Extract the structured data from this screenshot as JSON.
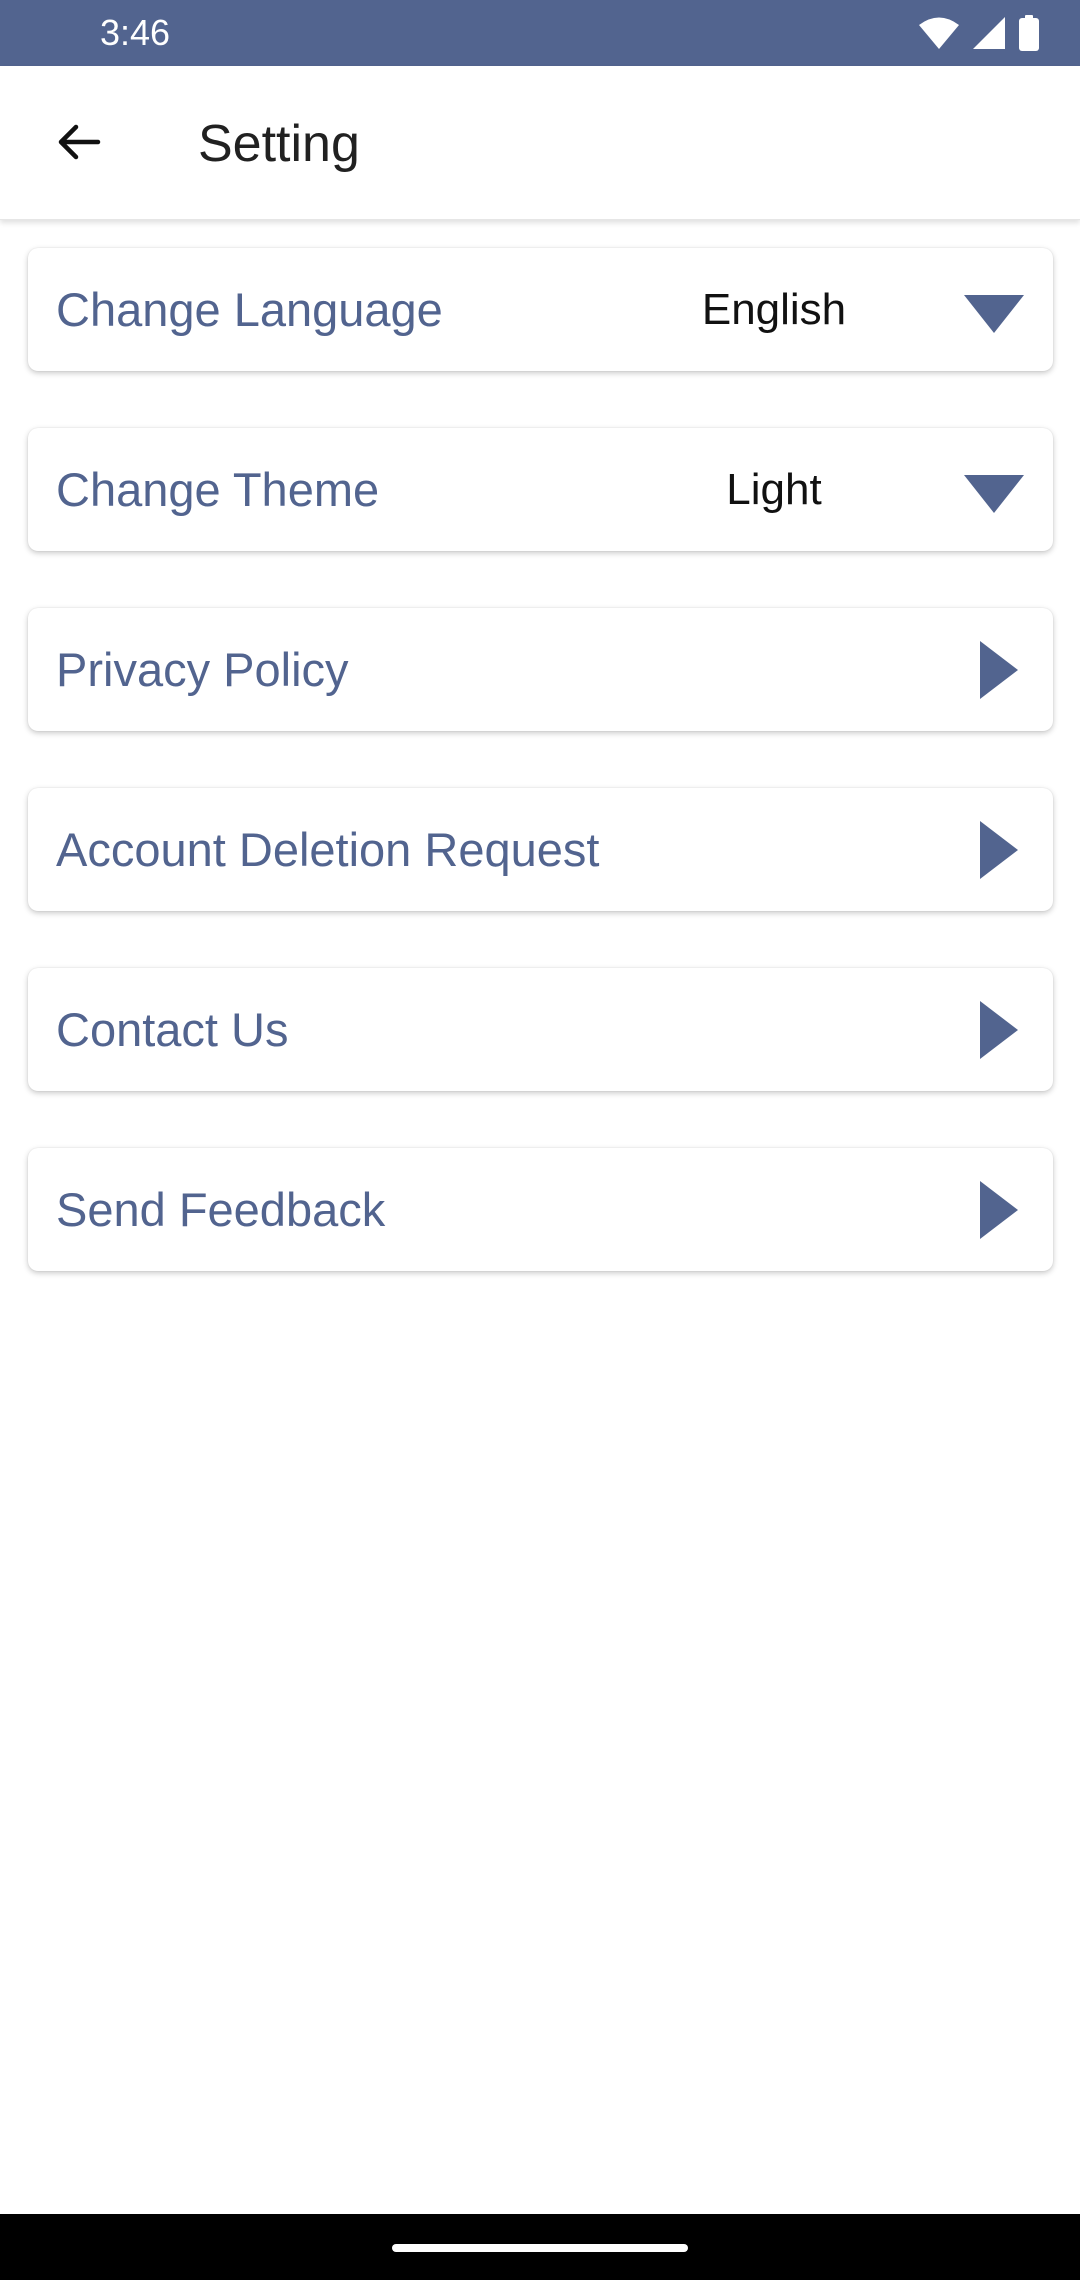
{
  "status_bar": {
    "time": "3:46",
    "icons": [
      "wifi-icon",
      "cellular-signal-icon",
      "battery-icon"
    ],
    "background": "#52648f"
  },
  "app_bar": {
    "back_icon": "arrow-left-icon",
    "title": "Setting"
  },
  "settings": {
    "items": [
      {
        "label": "Change Language",
        "value": "English",
        "icon": "dropdown-triangle-icon"
      },
      {
        "label": "Change Theme",
        "value": "Light",
        "icon": "dropdown-triangle-icon"
      },
      {
        "label": "Privacy Policy",
        "icon": "chevron-right-triangle-icon"
      },
      {
        "label": "Account Deletion Request",
        "icon": "chevron-right-triangle-icon"
      },
      {
        "label": "Contact Us",
        "icon": "chevron-right-triangle-icon"
      },
      {
        "label": "Send Feedback",
        "icon": "chevron-right-triangle-icon"
      }
    ]
  },
  "colors": {
    "accent": "#52648f",
    "text_primary": "#212121",
    "background": "#ffffff",
    "nav_bar": "#000000"
  }
}
